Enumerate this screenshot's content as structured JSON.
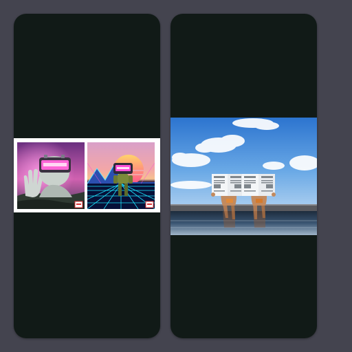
{
  "gallery": {
    "cards": [
      {
        "image": {
          "icon": "retro-vr-robot-collage-image",
          "panels": [
            {
              "icon": "vr-headset-sculpture-image",
              "badge_icon": "logo-badge-icon"
            },
            {
              "icon": "synthwave-grid-robot-image",
              "badge_icon": "logo-badge-icon"
            }
          ]
        }
      },
      {
        "image": {
          "icon": "infinity-pool-newspaper-readers-image"
        }
      }
    ]
  },
  "colors": {
    "page_background": "#44444f",
    "card_background": "#111a17",
    "sky_blue": "#3d86d6",
    "neon_pink": "#ff4fd8",
    "neon_cyan": "#1ee6ff"
  }
}
